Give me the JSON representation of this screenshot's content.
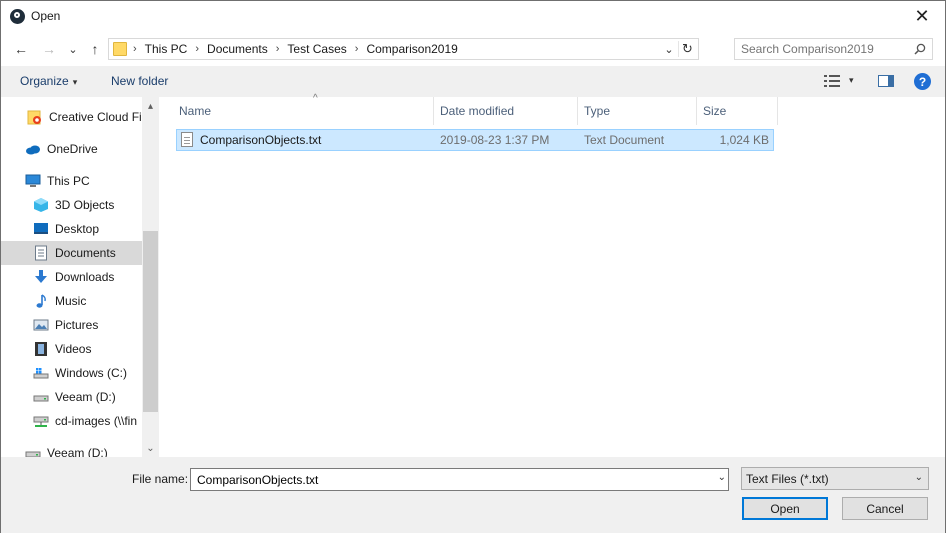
{
  "window": {
    "title": "Open",
    "close_glyph": "✕"
  },
  "nav": {
    "back_glyph": "←",
    "forward_glyph": "→",
    "recent_glyph": "⌄",
    "up_glyph": "↑",
    "breadcrumbs": [
      "This PC",
      "Documents",
      "Test Cases",
      "Comparison2019"
    ],
    "crumb_sep": "›",
    "dropdown_glyph": "⌄",
    "refresh_glyph": "↻",
    "search_placeholder": "Search Comparison2019"
  },
  "commands": {
    "organize": "Organize",
    "new_folder": "New folder",
    "caret": "▾",
    "help": "?"
  },
  "sidebar": {
    "scroll_up": "▴",
    "scroll_down": "⌄",
    "items": [
      {
        "label": "Creative Cloud Fil",
        "icon": "creative-cloud-icon"
      },
      {
        "label": "OneDrive",
        "icon": "onedrive-icon"
      },
      {
        "label": "This PC",
        "icon": "this-pc-icon"
      },
      {
        "label": "3D Objects",
        "icon": "3d-objects-icon"
      },
      {
        "label": "Desktop",
        "icon": "desktop-icon"
      },
      {
        "label": "Documents",
        "icon": "documents-icon",
        "selected": true
      },
      {
        "label": "Downloads",
        "icon": "downloads-icon"
      },
      {
        "label": "Music",
        "icon": "music-icon"
      },
      {
        "label": "Pictures",
        "icon": "pictures-icon"
      },
      {
        "label": "Videos",
        "icon": "videos-icon"
      },
      {
        "label": "Windows (C:)",
        "icon": "drive-icon"
      },
      {
        "label": "Veeam (D:)",
        "icon": "drive-icon"
      },
      {
        "label": "cd-images (\\\\fin",
        "icon": "network-drive-icon"
      },
      {
        "label": "Veeam (D:)",
        "icon": "drive-icon"
      }
    ]
  },
  "filelist": {
    "sort_glyph": "^",
    "columns": [
      "Name",
      "Date modified",
      "Type",
      "Size"
    ],
    "rows": [
      {
        "name": "ComparisonObjects.txt",
        "date": "2019-08-23 1:37 PM",
        "type": "Text Document",
        "size": "1,024 KB"
      }
    ]
  },
  "bottom": {
    "file_name_label": "File name:",
    "file_name_value": "ComparisonObjects.txt",
    "file_type": "Text Files (*.txt)",
    "dropdown_glyph": "⌄",
    "open_label": "Open",
    "cancel_label": "Cancel"
  },
  "colors": {
    "accent": "#0078d7",
    "selection": "#cce8ff",
    "selection_border": "#99d1ff",
    "folder": "#ffd966"
  }
}
